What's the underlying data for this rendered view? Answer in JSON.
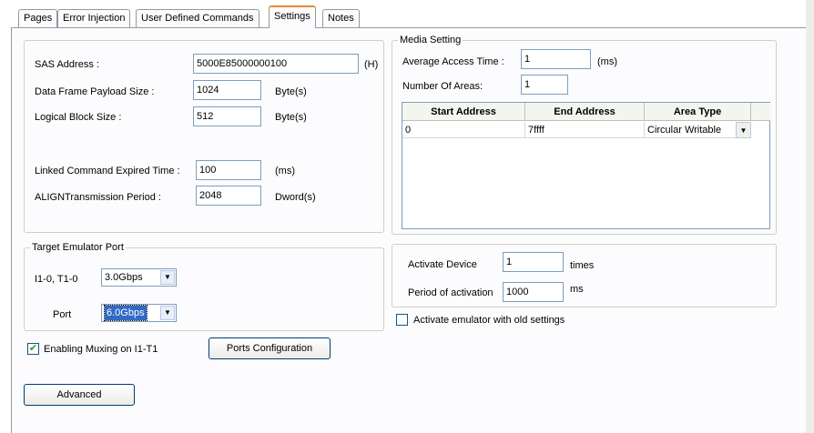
{
  "tabs": [
    {
      "label": "Pages"
    },
    {
      "label": "Error Injection"
    },
    {
      "label": "User Defined Commands"
    },
    {
      "label": "Settings"
    },
    {
      "label": "Notes"
    }
  ],
  "device": {
    "sas_address_label": "SAS Address :",
    "sas_address_value": "5000E85000000100",
    "sas_address_unit": "(H)",
    "payload_label": "Data Frame Payload Size :",
    "payload_value": "1024",
    "payload_unit": "Byte(s)",
    "block_label": "Logical Block Size :",
    "block_value": "512",
    "block_unit": "Byte(s)",
    "linked_label": "Linked Command Expired Time :",
    "linked_value": "100",
    "linked_unit": "(ms)",
    "align_label": "ALIGNTransmission Period :",
    "align_value": "2048",
    "align_unit": "Dword(s)"
  },
  "media": {
    "title": "Media Setting",
    "access_label": "Average Access Time :",
    "access_value": "1",
    "access_unit": "(ms)",
    "areas_label": "Number Of Areas:",
    "areas_value": "1",
    "columns": [
      "Start Address",
      "End Address",
      "Area Type"
    ],
    "rows": [
      {
        "start": "0",
        "end": "7ffff",
        "type": "Circular Writable"
      }
    ]
  },
  "port": {
    "title": "Target Emulator Port",
    "i1_label": "I1-0, T1-0",
    "i1_value": "3.0Gbps",
    "port_label": "Port",
    "port_value": "6.0Gbps"
  },
  "activate": {
    "device_label": "Activate Device",
    "device_value": "1",
    "device_unit": "times",
    "period_label": "Period of activation",
    "period_value": "1000",
    "period_unit": "ms"
  },
  "options": {
    "old_settings_label": "Activate emulator with old settings",
    "old_settings_checked": false,
    "muxing_label": "Enabling Muxing on I1-T1",
    "muxing_checked": true
  },
  "buttons": {
    "ports_config": "Ports Configuration",
    "advanced": "Advanced"
  }
}
